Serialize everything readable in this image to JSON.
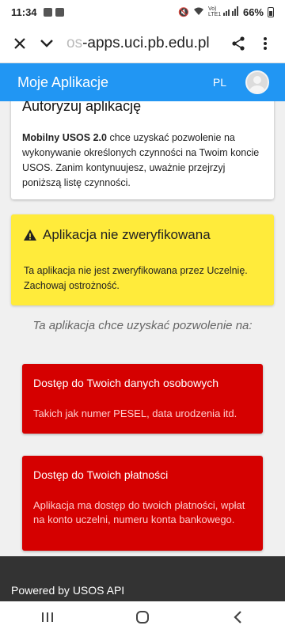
{
  "status": {
    "time": "11:34",
    "network": "Vo) LTE1",
    "battery": "66%"
  },
  "browser": {
    "url_fade": "os",
    "url": "-apps.uci.pb.edu.pl",
    "close_icon": "close-icon",
    "expand_icon": "chevron-down-icon",
    "share_icon": "share-icon",
    "menu_icon": "more-vert-icon"
  },
  "appbar": {
    "title": "Moje Aplikacje",
    "lang": "PL",
    "color": "#2196f3"
  },
  "auth": {
    "title": "Autoryzuj aplikację",
    "app_name": "Mobilny USOS 2.0",
    "text": " chce uzyskać pozwolenie na wykonywanie określonych czynności na Twoim koncie USOS. Zanim kontynuujesz, uważnie przejrzyj poniższą listę czynności."
  },
  "warning": {
    "title": "Aplikacja nie zweryfikowana",
    "text": "Ta aplikacja nie jest zweryfikowana przez Uczelnię. Zachowaj ostrożność.",
    "color": "#ffeb3b"
  },
  "permissions": {
    "heading": "Ta aplikacja chce uzyskać pozwolenie na:",
    "color": "#d50000",
    "items": [
      {
        "title": "Dostęp do Twoich danych osobowych",
        "desc": "Takich jak numer PESEL, data urodzenia itd."
      },
      {
        "title": "Dostęp do Twoich płatności",
        "desc": "Aplikacja ma dostęp do twoich płatności, wpłat na konto uczelni, numeru konta bankowego."
      }
    ]
  },
  "footer": {
    "text": "Powered by USOS API"
  }
}
